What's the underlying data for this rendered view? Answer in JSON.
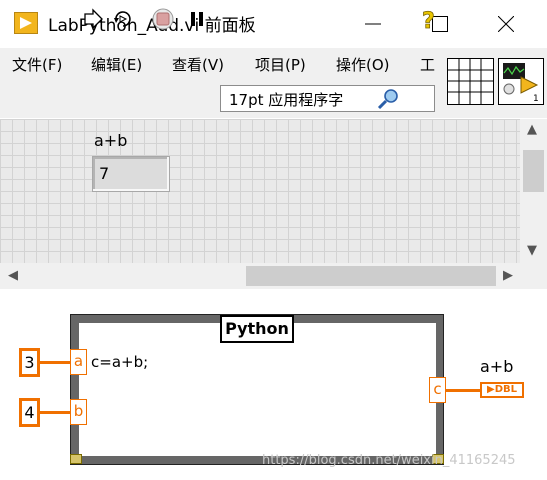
{
  "window": {
    "title": "LabPython_Add.vi 前面板",
    "controls": [
      "minimize-icon",
      "maximize-icon",
      "close-icon"
    ]
  },
  "menu": {
    "items": [
      "文件(F)",
      "编辑(E)",
      "查看(V)",
      "项目(P)",
      "操作(O)",
      "工"
    ]
  },
  "toolbar": {
    "icons": [
      "run-arrow-icon",
      "run-continuously-icon",
      "abort-icon",
      "pause-icon",
      "search-icon",
      "help-icon"
    ],
    "font_ring": "17pt 应用程序字"
  },
  "front_panel": {
    "indicator_label": "a+b",
    "indicator_value": "7"
  },
  "block_diagram": {
    "node_title": "Python",
    "code": "c=a+b;",
    "inputs": [
      {
        "const": "3",
        "terminal": "a"
      },
      {
        "const": "4",
        "terminal": "b"
      }
    ],
    "output_terminal": "c",
    "output_label": "a+b",
    "output_indicator": "DBL"
  },
  "watermark": "https://blog.csdn.net/weixin_41165245",
  "colors": {
    "wire": "#f07000",
    "node_frame": "#666666",
    "canvas": "#eaeaea"
  }
}
